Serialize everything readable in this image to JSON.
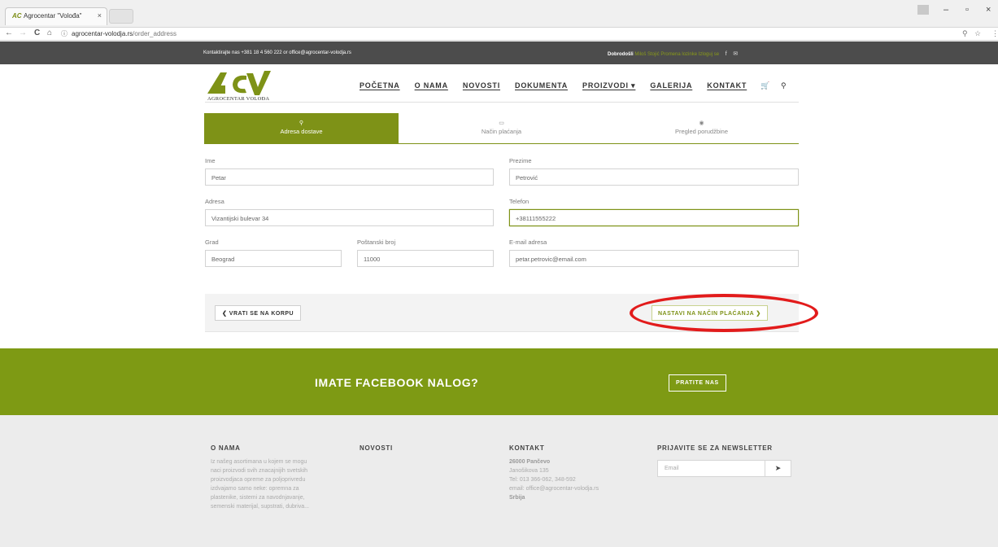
{
  "browser": {
    "tab_title": "Agrocentar \"Volođa\"",
    "tab_close": "×",
    "url_host": "agrocentar-volodja.rs",
    "url_path": "/order_address",
    "back_glyph": "←",
    "forward_glyph": "→",
    "reload_glyph": "C",
    "home_glyph": "⌂",
    "minimize": "–",
    "restore": "▫",
    "close": "×"
  },
  "topbar": {
    "contact": "Kontaktirajte nas +381 18 4 560 222 or office@agrocentar-volodja.rs",
    "welcome": "Dobrodošli",
    "user_links": "Miloš Stojić Promena lozinke Izloguj se"
  },
  "header": {
    "logo_text": "AGROCENTAR VOLOĐA",
    "nav": [
      "POČETNA",
      "O NAMA",
      "NOVOSTI",
      "DOKUMENTA",
      "PROIZVODI ▾",
      "GALERIJA",
      "KONTAKT"
    ]
  },
  "steps": [
    {
      "label": "Adresa dostave",
      "icon": "map-pin-icon",
      "active": true
    },
    {
      "label": "Način plaćanja",
      "icon": "money-icon",
      "active": false
    },
    {
      "label": "Pregled porudžbine",
      "icon": "eye-icon",
      "active": false
    }
  ],
  "form": {
    "ime_label": "Ime",
    "ime_value": "Petar",
    "prezime_label": "Prezime",
    "prezime_value": "Petrović",
    "adresa_label": "Adresa",
    "adresa_value": "Vizantijski bulevar 34",
    "telefon_label": "Telefon",
    "telefon_value": "+38111555222",
    "grad_label": "Grad",
    "grad_value": "Beograd",
    "postanski_label": "Poštanski broj",
    "postanski_value": "11000",
    "email_label": "E-mail adresa",
    "email_value": "petar.petrovic@email.com"
  },
  "actions": {
    "back_label": "❮ VRATI SE NA KORPU",
    "next_label": "NASTAVI NA NAČIN PLAĆANJA ❯"
  },
  "facebook": {
    "title": "IMATE FACEBOOK NALOG?",
    "button": "PRATITE NAS"
  },
  "footer": {
    "o_nama_title": "O NAMA",
    "o_nama_lines": [
      "Iz našeg asortimana u kojem se mogu",
      "naci proizvodi svih znacajnijih svetskih",
      "proizvodjaca opreme za poljoprivredu",
      "izdvajamo samo neke: opremna za",
      "plastenike, sistemi za navodnjavanje,",
      "semenski materijal, supstrati, dubriva..."
    ],
    "novosti_title": "NOVOSTI",
    "kontakt_title": "KONTAKT",
    "kontakt_city": "26000 Pančevo",
    "kontakt_street": "Janošikova 135",
    "kontakt_tel": "Tel: 013 366-062, 348-592",
    "kontakt_email": "email: office@agrocentar-volodja.rs",
    "kontakt_country": "Srbija",
    "newsletter_title": "PRIJAVITE SE ZA NEWSLETTER",
    "newsletter_placeholder": "Email"
  },
  "colors": {
    "brand_green": "#7e9217",
    "banner_green": "#7e9a14",
    "topbar_gray": "#4c4c4c",
    "highlight_red": "#e21b1b"
  }
}
